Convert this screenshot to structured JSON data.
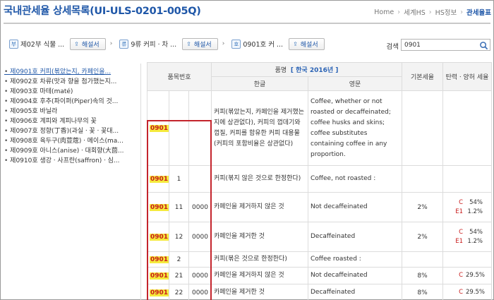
{
  "title": "국내관세율 상세목록(UI-ULS-0201-005Q)",
  "breadcrumb": [
    "Home",
    "세계HS",
    "HS정보",
    "관세율표"
  ],
  "filters": [
    {
      "tag": "부",
      "label": "제02부 식물 ..."
    },
    {
      "tag": "류",
      "label": "9류 커피ㆍ차 ..."
    },
    {
      "tag": "호",
      "label": "0901호 커 ..."
    }
  ],
  "explain_btn": "해설서",
  "search": {
    "label": "검색",
    "value": "0901"
  },
  "sidebar": [
    "제0901호 커피(볶았는지, 카페인을...",
    "제0902호 차류(맛과 향을 첨가했는지...",
    "제0903호 마테(maté)",
    "제0904호 후추(파이퍼(Piper)속의 것...",
    "제0905호 바닐라",
    "제0906호 계피와 계피나무의 꽃",
    "제0907호 정향(丁香)(과실ㆍ꽃ㆍ꽃대...",
    "제0908호 육두구(肉荳蔲)ㆍ메이스(ma...",
    "제0909호 아니스(anise)ㆍ대회향(大茴...",
    "제0910호 생강ㆍ사프란(saffron)ㆍ심..."
  ],
  "table": {
    "h_item": "품목번호",
    "h_name": "품명",
    "h_name_sub": "[ 한국 2016년 ]",
    "h_ko": "한글",
    "h_en": "영문",
    "h_base": "기본세율",
    "h_elastic": "탄력ㆍ양허 세율",
    "rows": [
      {
        "hs": "0901",
        "sub": "",
        "sub2": "",
        "ko": "커피(볶았는지, 카페인을 제거했는지에 상관없다), 커피의 껍데기와 껍질, 커피를 함유한 커피 대용물(커피의 포함비율은 상관없다)",
        "en": "Coffee, whether or not roasted or decaffeinated; coffee husks and skins; coffee substitutes containing coffee in any proportion.",
        "base": "",
        "rates": []
      },
      {
        "hs": "0901",
        "sub": "1",
        "sub2": "",
        "ko": "커피(볶지 않은 것으로 한정한다)",
        "en": "Coffee, not roasted :",
        "base": "",
        "rates": []
      },
      {
        "hs": "0901",
        "sub": "11",
        "sub2": "0000",
        "ko": "카페인을 제거하지 않은 것",
        "en": "Not decaffeinated",
        "base": "2%",
        "rates": [
          {
            "k": "C",
            "v": "54%"
          },
          {
            "k": "E1",
            "v": "1.2%"
          }
        ]
      },
      {
        "hs": "0901",
        "sub": "12",
        "sub2": "0000",
        "ko": "카페인을 제거한 것",
        "en": "Decaffeinated",
        "base": "2%",
        "rates": [
          {
            "k": "C",
            "v": "54%"
          },
          {
            "k": "E1",
            "v": "1.2%"
          }
        ]
      },
      {
        "hs": "0901",
        "sub": "2",
        "sub2": "",
        "ko": "커피(볶은 것으로 한정한다)",
        "en": "Coffee roasted :",
        "base": "",
        "rates": []
      },
      {
        "hs": "0901",
        "sub": "21",
        "sub2": "0000",
        "ko": "카페인을 제거하지 않은 것",
        "en": "Not decaffeinated",
        "base": "8%",
        "rates": [
          {
            "k": "C",
            "v": "29.5%"
          }
        ]
      },
      {
        "hs": "0901",
        "sub": "22",
        "sub2": "0000",
        "ko": "카페인을 제거한 것",
        "en": "Decaffeinated",
        "base": "8%",
        "rates": [
          {
            "k": "C",
            "v": "29.5%"
          }
        ]
      }
    ]
  },
  "colors": {
    "brand": "#1f57a8",
    "highlight": "#f5ea3d",
    "box": "#c4242c",
    "rate_key": "#c81b1b"
  }
}
